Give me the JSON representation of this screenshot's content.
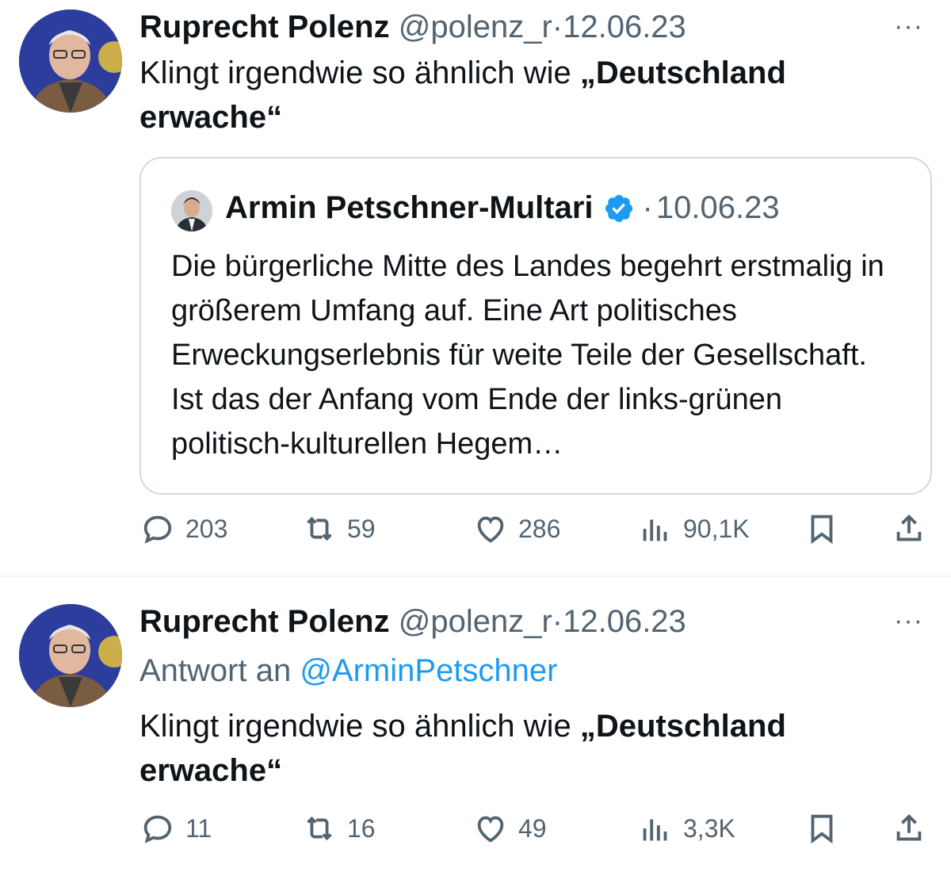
{
  "tweet1": {
    "author_name": "Ruprecht Polenz",
    "handle": "@polenz_r",
    "separator": "·",
    "date": "12.06.23",
    "more": "···",
    "text_plain": "Klingt irgendwie so ähnlich wie ",
    "text_bold": "„Deutschland erwache“",
    "quote": {
      "author_name": "Armin Petschner-Multari",
      "separator": "·",
      "date": "10.06.23",
      "text": "Die bürgerliche Mitte des Landes begehrt erstmalig in größerem Umfang auf. Eine Art politisches Erweckungserlebnis für weite Teile der Gesellschaft. Ist das der Anfang vom Ende der links-grünen politisch-kulturellen Hegem…"
    },
    "actions": {
      "replies": "203",
      "retweets": "59",
      "likes": "286",
      "views": "90,1K"
    }
  },
  "tweet2": {
    "author_name": "Ruprecht Polenz",
    "handle": "@polenz_r",
    "separator": "·",
    "date": "12.06.23",
    "more": "···",
    "reply_prefix": "Antwort an ",
    "reply_handle": "@ArminPetschner",
    "text_plain": "Klingt irgendwie so ähnlich wie ",
    "text_bold": "„Deutschland erwache“",
    "actions": {
      "replies": "11",
      "retweets": "16",
      "likes": "49",
      "views": "3,3K"
    }
  },
  "icons": {
    "reply": "reply-icon",
    "retweet": "retweet-icon",
    "like": "like-icon",
    "views": "views-icon",
    "bookmark": "bookmark-icon",
    "share": "share-icon",
    "verified": "verified-badge-icon"
  },
  "colors": {
    "text": "#0f1419",
    "muted": "#536471",
    "link": "#1d9bf0",
    "border": "#cfd9de"
  }
}
